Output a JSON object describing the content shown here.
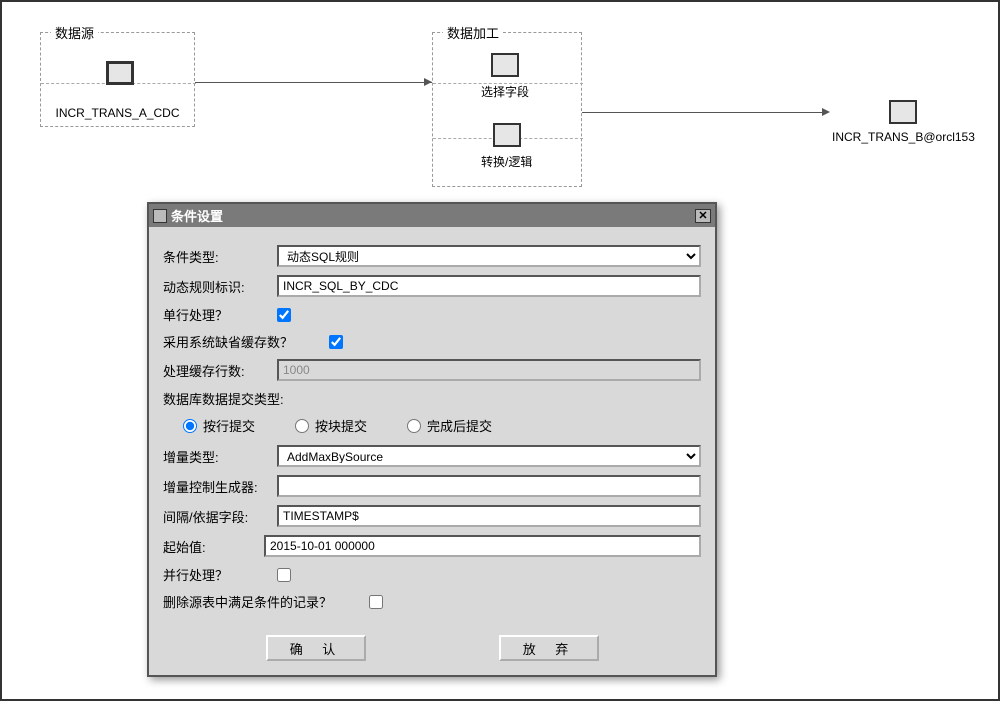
{
  "flow": {
    "source_group": "数据源",
    "source_node": "INCR_TRANS_A_CDC",
    "process_group": "数据加工",
    "process_node1": "选择字段",
    "process_node2": "转换/逻辑",
    "target_node": "INCR_TRANS_B@orcl153"
  },
  "dialog": {
    "title": "条件设置",
    "labels": {
      "cond_type": "条件类型:",
      "rule_id": "动态规则标识:",
      "single_row": "单行处理？",
      "use_sys_cache": "采用系统缺省缓存数？",
      "cache_rows": "处理缓存行数:",
      "commit_type": "数据库数据提交类型:",
      "incr_type": "增量类型:",
      "incr_gen": "增量控制生成器:",
      "interval_field": "间隔/依据字段:",
      "start_value": "起始值:",
      "parallel": "并行处理？",
      "delete_src": "删除源表中满足条件的记录？"
    },
    "values": {
      "cond_type": "动态SQL规则",
      "rule_id": "INCR_SQL_BY_CDC",
      "single_row": true,
      "use_sys_cache": true,
      "cache_rows": "1000",
      "commit_type": "row",
      "incr_type": "AddMaxBySource",
      "incr_gen": "",
      "interval_field": "TIMESTAMP$",
      "start_value": "2015-10-01 000000",
      "parallel": false,
      "delete_src": false
    },
    "commit_options": {
      "row": "按行提交",
      "block": "按块提交",
      "after": "完成后提交"
    },
    "buttons": {
      "ok": "确 认",
      "cancel": "放 弃"
    }
  }
}
